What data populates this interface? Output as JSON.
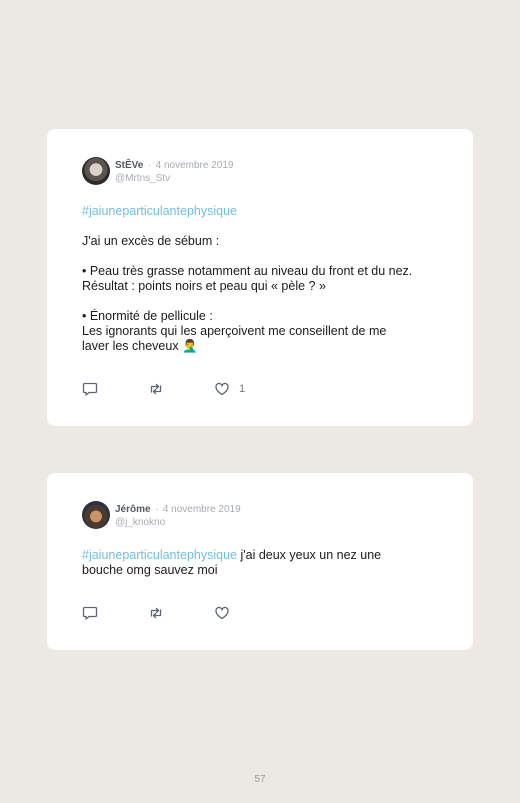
{
  "tweets": [
    {
      "author": "StÊVe",
      "separator": "·",
      "date": "4 novembre 2019",
      "handle": "@Mrtns_Stv",
      "hashtag": "#jaiuneparticulantephysique",
      "lines": [
        "J'ai un excès de sébum :",
        "• Peau très grasse notamment au niveau du front et du nez.",
        "Résultat : points noirs et peau qui « pèle ? »",
        "• Énormité de pellicule :",
        "Les ignorants qui les aperçoivent me conseillent de me",
        "laver les cheveux 🤦‍♂️"
      ],
      "reply_icon": "reply-icon",
      "retweet_icon": "retweet-icon",
      "like_icon": "heart-icon",
      "like_count": "1"
    },
    {
      "author": "Jérôme",
      "separator": "·",
      "date": "4 novembre 2019",
      "handle": "@j_knokno",
      "hashtag": "#jaiuneparticulantephysique",
      "text_after_hashtag": " j'ai deux yeux un nez une",
      "line2": "bouche omg sauvez moi",
      "reply_icon": "reply-icon",
      "retweet_icon": "retweet-icon",
      "like_icon": "heart-icon"
    }
  ],
  "page_number": "57",
  "colors": {
    "background": "#ece9e4",
    "hashtag": "#6fbfe2",
    "muted": "#a7abb0"
  }
}
